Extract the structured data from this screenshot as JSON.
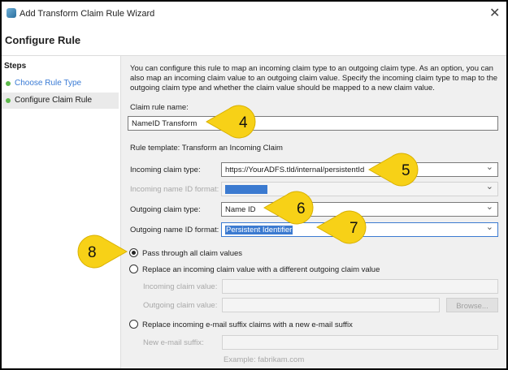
{
  "window": {
    "title": "Add Transform Claim Rule Wizard",
    "close_icon": "close-icon"
  },
  "header": "Configure Rule",
  "steps": {
    "title": "Steps",
    "items": [
      {
        "label": "Choose Rule Type",
        "link": true
      },
      {
        "label": "Configure Claim Rule",
        "active": true
      }
    ]
  },
  "description": "You can configure this rule to map an incoming claim type to an outgoing claim type. As an option, you can also map an incoming claim value to an outgoing claim value. Specify the incoming claim type to map to the outgoing claim type and whether the claim value should be mapped to a new claim value.",
  "form": {
    "rule_name_label": "Claim rule name:",
    "rule_name_value": "NameID Transform",
    "template": "Rule template: Transform an Incoming Claim",
    "incoming_type_label": "Incoming claim type:",
    "incoming_type_value": "https://YourADFS.tld/internal/persistentId",
    "incoming_format_label": "Incoming name ID format:",
    "incoming_format_value": "Unspecified",
    "outgoing_type_label": "Outgoing claim type:",
    "outgoing_type_value": "Name ID",
    "outgoing_format_label": "Outgoing name ID format:",
    "outgoing_format_value": "Persistent Identifier",
    "radio_pass": "Pass through all claim values",
    "radio_replace": "Replace an incoming claim value with a different outgoing claim value",
    "incoming_value_label": "Incoming claim value:",
    "outgoing_value_label": "Outgoing claim value:",
    "browse": "Browse...",
    "radio_email": "Replace incoming e-mail suffix claims with a new e-mail suffix",
    "email_suffix_label": "New e-mail suffix:",
    "example": "Example: fabrikam.com",
    "selected_radio": "pass"
  },
  "callouts": [
    "4",
    "5",
    "6",
    "7",
    "8"
  ],
  "colors": {
    "callout": "#f7d117",
    "selection": "#3b7ad0",
    "link": "#3a7bd5"
  }
}
